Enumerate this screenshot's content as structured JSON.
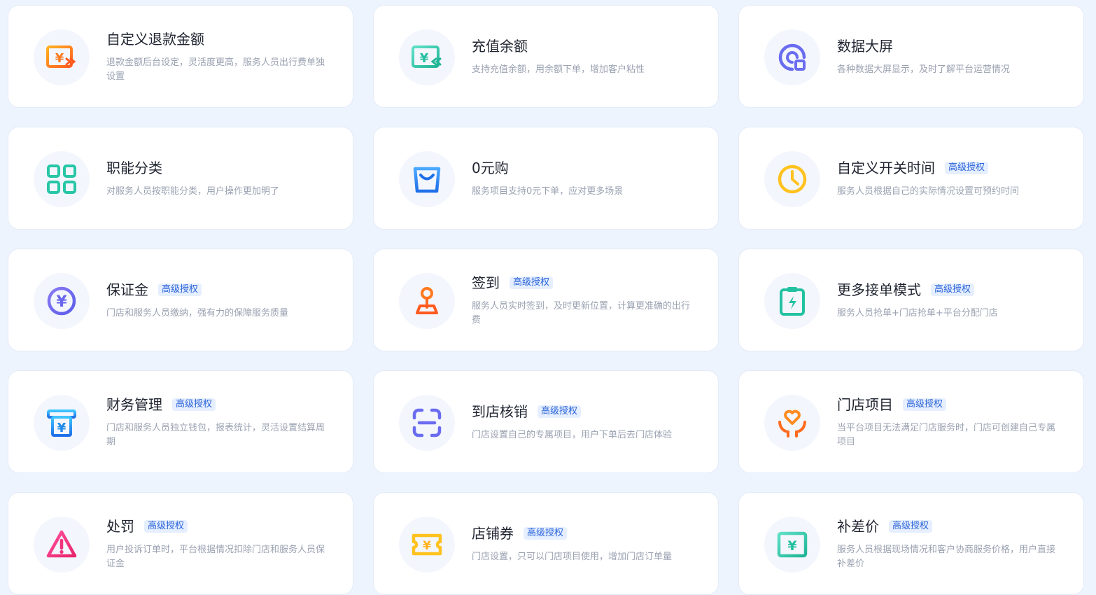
{
  "badge_label": "高级授权",
  "cards": [
    {
      "title": "自定义退款金额",
      "desc": "退款金额后台设定，灵活度更高，服务人员出行费单独设置",
      "icon": "refund-yen-icon",
      "badge": false
    },
    {
      "title": "充值余额",
      "desc": "支持充值余额，用余额下单，增加客户粘性",
      "icon": "recharge-yen-icon",
      "badge": false
    },
    {
      "title": "数据大屏",
      "desc": "各种数据大屏显示，及时了解平台运营情况",
      "icon": "data-screen-icon",
      "badge": false
    },
    {
      "title": "职能分类",
      "desc": "对服务人员按职能分类，用户操作更加明了",
      "icon": "category-grid-icon",
      "badge": false
    },
    {
      "title": "0元购",
      "desc": "服务项目支持0元下单，应对更多场景",
      "icon": "shopping-bag-icon",
      "badge": false
    },
    {
      "title": "自定义开关时间",
      "desc": "服务人员根据自己的实际情况设置可预约时间",
      "icon": "clock-icon",
      "badge": true
    },
    {
      "title": "保证金",
      "desc": "门店和服务人员缴纳，强有力的保障服务质量",
      "icon": "yen-coin-icon",
      "badge": true
    },
    {
      "title": "签到",
      "desc": "服务人员实时签到，及时更新位置，计算更准确的出行费",
      "icon": "location-pin-icon",
      "badge": true
    },
    {
      "title": "更多接单模式",
      "desc": "服务人员抢单+门店抢单+平台分配门店",
      "icon": "clipboard-lightning-icon",
      "badge": true
    },
    {
      "title": "财务管理",
      "desc": "门店和服务人员独立钱包，报表统计，灵活设置结算周期",
      "icon": "finance-register-icon",
      "badge": true
    },
    {
      "title": "到店核销",
      "desc": "门店设置自己的专属项目，用户下单后去门店体验",
      "icon": "scan-icon",
      "badge": true
    },
    {
      "title": "门店项目",
      "desc": "当平台项目无法满足门店服务时，门店可创建自己专属项目",
      "icon": "heart-hands-icon",
      "badge": true
    },
    {
      "title": "处罚",
      "desc": "用户投诉订单时，平台根据情况扣除门店和服务人员保证金",
      "icon": "warning-triangle-icon",
      "badge": true
    },
    {
      "title": "店铺券",
      "desc": "门店设置，只可以门店项目使用，增加门店订单量",
      "icon": "coupon-ticket-icon",
      "badge": true
    },
    {
      "title": "补差价",
      "desc": "服务人员根据现场情况和客户协商服务价格，用户直接补差价",
      "icon": "yen-card-icon",
      "badge": true
    }
  ]
}
